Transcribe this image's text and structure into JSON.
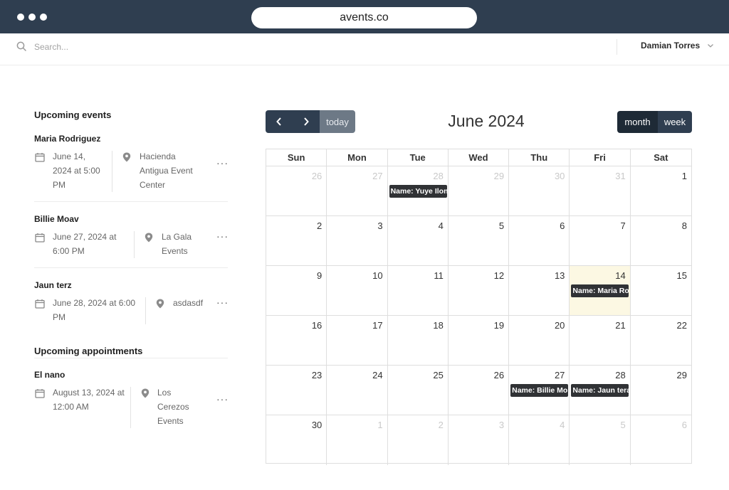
{
  "browser": {
    "url": "avents.co"
  },
  "search": {
    "placeholder": "Search..."
  },
  "user": {
    "name": "Damian Torres"
  },
  "sidebar": {
    "events_title": "Upcoming events",
    "events": [
      {
        "name": "Maria Rodriguez",
        "date": "June 14, 2024 at 5:00 PM",
        "location": "Hacienda Antigua Event Center"
      },
      {
        "name": "Billie Moav",
        "date": "June 27, 2024 at 6:00 PM",
        "location": "La Gala Events"
      },
      {
        "name": "Jaun terz",
        "date": "June 28, 2024 at 6:00 PM",
        "location": "asdasdf"
      }
    ],
    "appointments_title": "Upcoming appointments",
    "appointments": [
      {
        "name": "El nano",
        "date": "August 13, 2024 at 12:00 AM",
        "location": "Los Cerezos Events"
      }
    ],
    "more_label": "···"
  },
  "calendar": {
    "title": "June 2024",
    "today_label": "today",
    "month_label": "month",
    "week_label": "week",
    "weekdays": [
      "Sun",
      "Mon",
      "Tue",
      "Wed",
      "Thu",
      "Fri",
      "Sat"
    ],
    "weeks": [
      [
        "26",
        "27",
        "28",
        "29",
        "30",
        "31",
        "1"
      ],
      [
        "2",
        "3",
        "4",
        "5",
        "6",
        "7",
        "8"
      ],
      [
        "9",
        "10",
        "11",
        "12",
        "13",
        "14",
        "15"
      ],
      [
        "16",
        "17",
        "18",
        "19",
        "20",
        "21",
        "22"
      ],
      [
        "23",
        "24",
        "25",
        "26",
        "27",
        "28",
        "29"
      ],
      [
        "30",
        "1",
        "2",
        "3",
        "4",
        "5",
        "6"
      ]
    ],
    "events": {
      "w0d2": "Name: Yuye Ilon",
      "w2d5": "Name: Maria Ro",
      "w4d4": "Name: Billie Mo",
      "w4d5": "Name: Jaun tera"
    }
  },
  "colors": {
    "chrome": "#2f3e50",
    "today_highlight": "#fcf8e3",
    "event_chip": "#303235"
  }
}
